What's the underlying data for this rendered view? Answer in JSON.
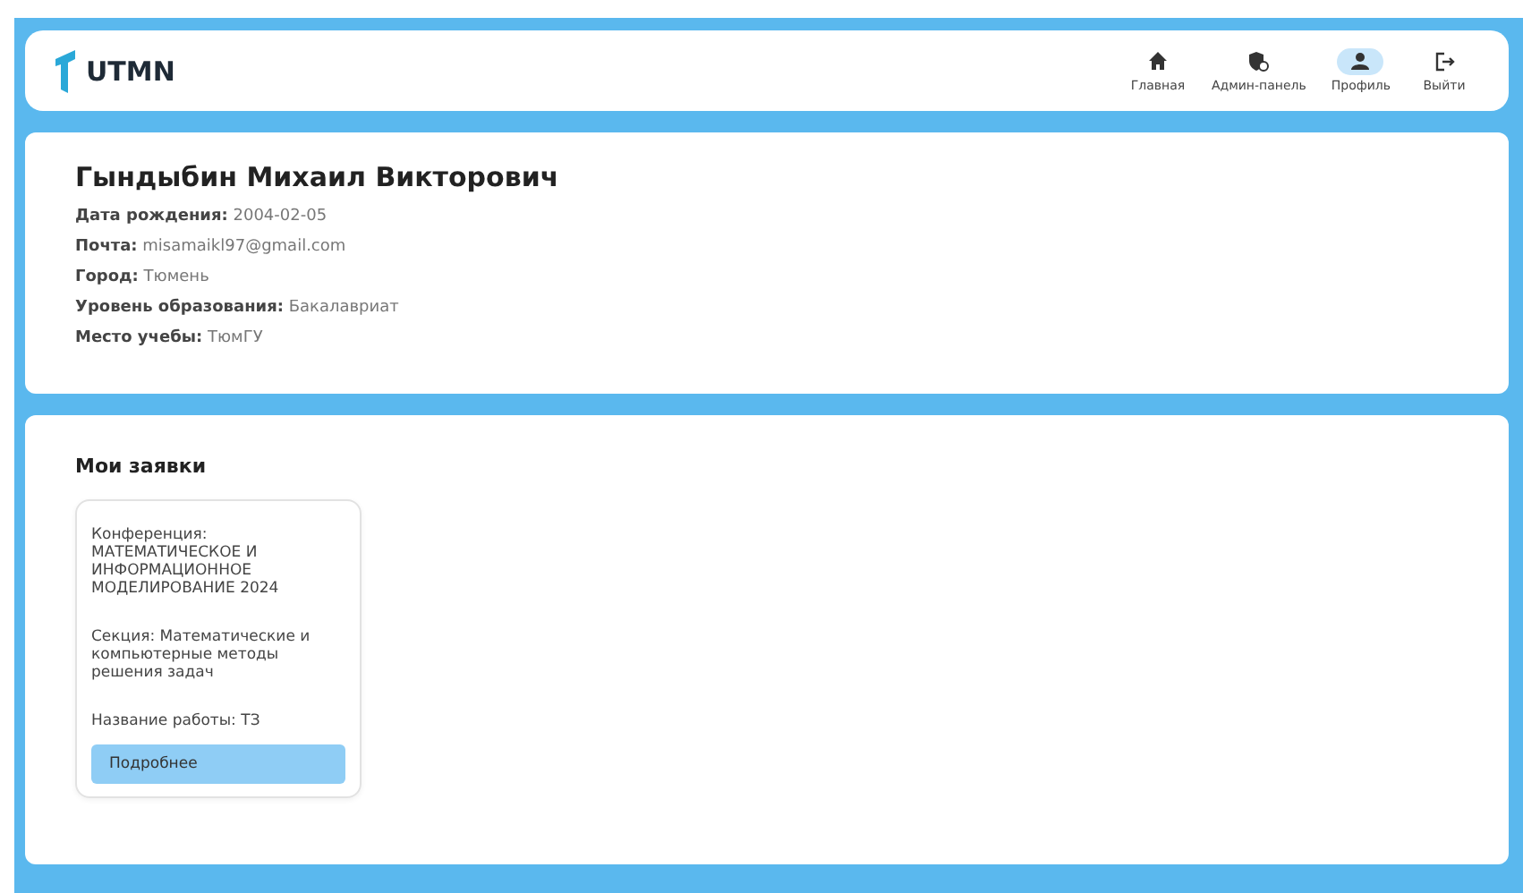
{
  "header": {
    "logo": "UTMN",
    "nav": [
      {
        "kind": "home",
        "label": "Главная",
        "selected": false
      },
      {
        "kind": "admin",
        "label": "Админ-панель",
        "selected": false
      },
      {
        "kind": "profile",
        "label": "Профиль",
        "selected": true
      },
      {
        "kind": "logout",
        "label": "Выйти",
        "selected": false
      }
    ]
  },
  "profile": {
    "name": "Гындыбин Михаил Викторович",
    "fields": [
      {
        "label": "Дата рождения:",
        "value": "2004-02-05"
      },
      {
        "label": "Почта:",
        "value": "misamaikl97@gmail.com"
      },
      {
        "label": "Город:",
        "value": "Тюмень"
      },
      {
        "label": "Уровень образования:",
        "value": "Бакалавриат"
      },
      {
        "label": "Место учебы:",
        "value": "ТюмГУ"
      }
    ]
  },
  "applications": {
    "title": "Мои заявки",
    "items": [
      {
        "conference": "Конференция: МАТЕМАТИЧЕСКОЕ И ИНФОРМАЦИОННОЕ МОДЕЛИРОВАНИЕ 2024",
        "section": "Секция: Математические и компьютерные методы решения задач",
        "work": "Название работы: ТЗ",
        "button": "Подробнее"
      }
    ]
  }
}
